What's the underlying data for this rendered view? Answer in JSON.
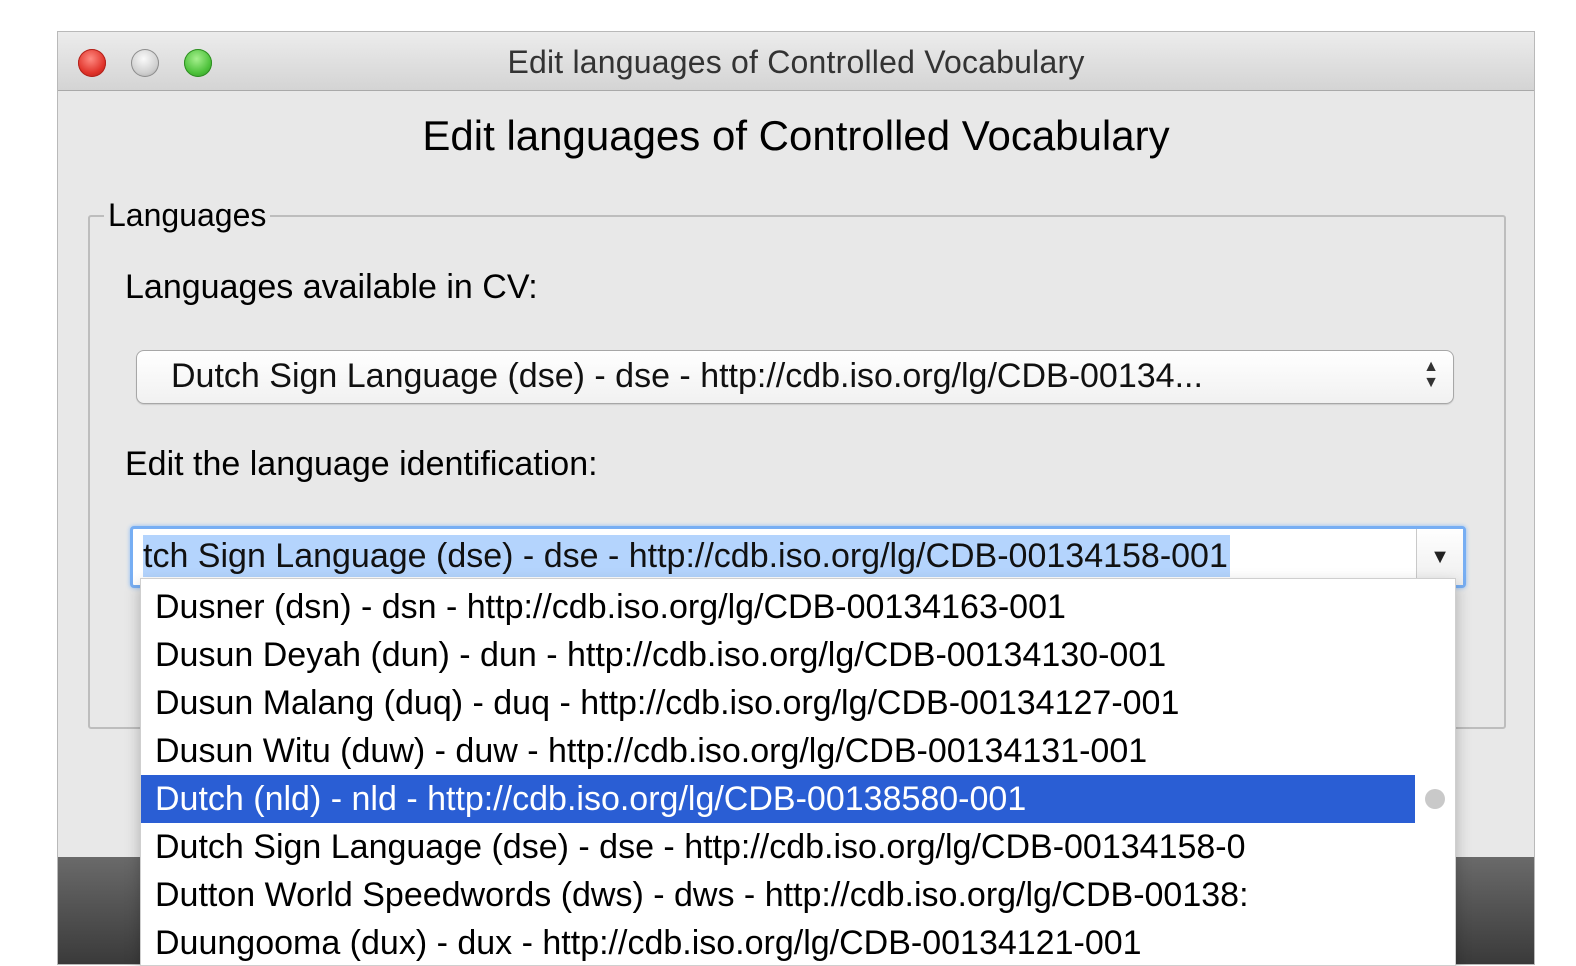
{
  "window": {
    "title": "Edit languages of Controlled Vocabulary"
  },
  "dialog": {
    "heading": "Edit languages of Controlled Vocabulary"
  },
  "languages_group": {
    "legend": "Languages",
    "available_label": "Languages available in CV:",
    "available_selected": "Dutch Sign Language (dse) - dse - http://cdb.iso.org/lg/CDB-00134...",
    "edit_label": "Edit the language identification:",
    "edit_value": "tch Sign Language (dse) - dse - http://cdb.iso.org/lg/CDB-00134158-001"
  },
  "dropdown": {
    "items": [
      "Dusner (dsn) - dsn - http://cdb.iso.org/lg/CDB-00134163-001",
      "Dusun Deyah (dun) - dun - http://cdb.iso.org/lg/CDB-00134130-001",
      "Dusun Malang (duq) - duq - http://cdb.iso.org/lg/CDB-00134127-001",
      "Dusun Witu (duw) - duw - http://cdb.iso.org/lg/CDB-00134131-001",
      "Dutch (nld) - nld - http://cdb.iso.org/lg/CDB-00138580-001",
      "Dutch Sign Language (dse) - dse - http://cdb.iso.org/lg/CDB-00134158-0",
      "Dutton World Speedwords (dws) - dws - http://cdb.iso.org/lg/CDB-00138:",
      "Duungooma (dux) - dux - http://cdb.iso.org/lg/CDB-00134121-001"
    ],
    "selected_index": 4
  },
  "icons": {
    "popup_arrows": "up-down-chevron-icon",
    "combo_arrow": "triangle-down-icon"
  },
  "colors": {
    "selection": "#2a5ed4",
    "text_highlight": "#b4d4fd",
    "focus_ring": "#77aef3"
  }
}
